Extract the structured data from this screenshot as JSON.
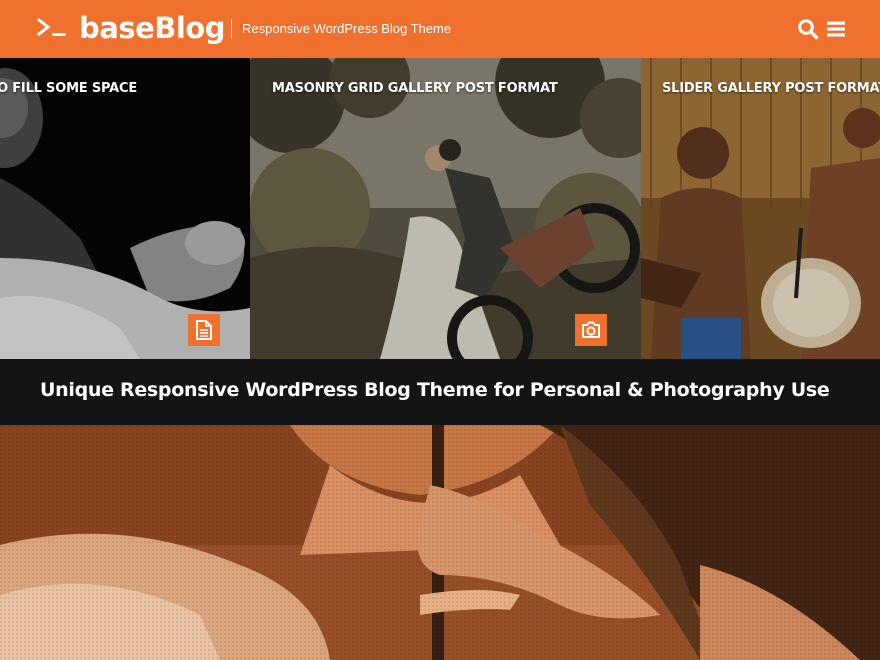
{
  "header": {
    "site_title": "baseBlog",
    "tagline": "Responsive WordPress Blog Theme",
    "logo_icon": "terminal-prompt-icon",
    "search_icon": "search-icon",
    "menu_icon": "hamburger-menu-icon",
    "background_color": "#f0712d"
  },
  "gallery": {
    "posts": [
      {
        "title": "TO FILL SOME SPACE",
        "format_icon": "document-icon"
      },
      {
        "title": "MASONRY GRID GALLERY POST FORMAT",
        "format_icon": "camera-icon"
      },
      {
        "title": "SLIDER GALLERY POST FORMAT"
      }
    ],
    "accent_color": "#f0712d"
  },
  "hero": {
    "headline": "Unique Responsive WordPress Blog Theme for Personal & Photography Use"
  }
}
